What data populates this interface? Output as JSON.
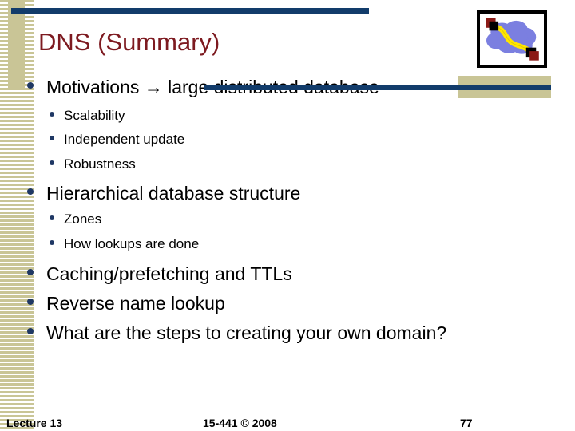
{
  "slide": {
    "title": "DNS (Summary)",
    "accent_navy": "#123c6b",
    "accent_tan": "#c9c596",
    "title_color": "#7d1a20",
    "bullet_color": "#1f3864"
  },
  "decor": {
    "cloud_icon_name": "network-cloud-icon",
    "cloud_body_color": "#7b7fe0",
    "cloud_link_color": "#ffe600",
    "node_outer_color": "#8b1a16",
    "node_inner_color": "#000000"
  },
  "content": {
    "bullets": [
      {
        "level": 1,
        "text": "Motivations → large distributed database"
      },
      {
        "level": 2,
        "text": "Scalability"
      },
      {
        "level": 2,
        "text": "Independent update"
      },
      {
        "level": 2,
        "text": "Robustness"
      },
      {
        "level": 1,
        "text": "Hierarchical database structure"
      },
      {
        "level": 2,
        "text": "Zones"
      },
      {
        "level": 2,
        "text": "How lookups are done"
      },
      {
        "level": 1,
        "text": "Caching/prefetching and TTLs"
      },
      {
        "level": 1,
        "text": "Reverse name lookup"
      },
      {
        "level": 1,
        "text": "What are the steps to creating your own domain?"
      }
    ]
  },
  "footer": {
    "left": "Lecture 13",
    "center": "15-441 © 2008",
    "right": "77"
  }
}
